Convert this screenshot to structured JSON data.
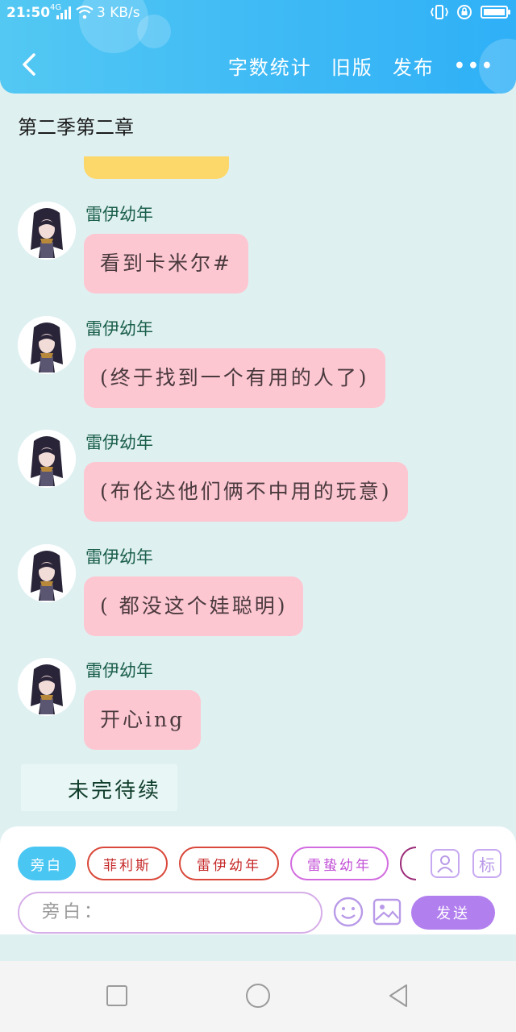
{
  "status_bar": {
    "time": "21:50",
    "network": "4G",
    "speed": "3 KB/s",
    "battery_percent": 90
  },
  "header": {
    "back_icon": "chevron-left-icon",
    "word_count_label": "字数统计",
    "old_version_label": "旧版",
    "publish_label": "发布",
    "more_label": "•••"
  },
  "chapter": {
    "title": "第二季第二章"
  },
  "messages": [
    {
      "sender": "雷伊幼年",
      "text": "看到卡米尔#"
    },
    {
      "sender": "雷伊幼年",
      "text": "(终于找到一个有用的人了)"
    },
    {
      "sender": "雷伊幼年",
      "text": "(布伦达他们俩不中用的玩意)"
    },
    {
      "sender": "雷伊幼年",
      "text": "( 都没这个娃聪明)"
    },
    {
      "sender": "雷伊幼年",
      "text": "开心ing"
    }
  ],
  "pending_note": "未完待续",
  "role_chips": [
    {
      "label": "旁白",
      "active": true
    },
    {
      "label": "菲利斯",
      "active": false
    },
    {
      "label": "雷伊幼年",
      "active": false
    },
    {
      "label": "雷蛰幼年",
      "active": false
    }
  ],
  "role_icons": {
    "contact_icon": "person-card-icon",
    "tag_label": "标"
  },
  "input": {
    "placeholder": "旁白：",
    "emoji_icon": "smiley-icon",
    "image_icon": "image-icon",
    "send_label": "发送"
  },
  "colors": {
    "header": "#3cb8f5",
    "bubble": "#fdc7d2",
    "background": "#dff0f1",
    "send": "#b27fef",
    "active_chip": "#4ac6f3"
  }
}
